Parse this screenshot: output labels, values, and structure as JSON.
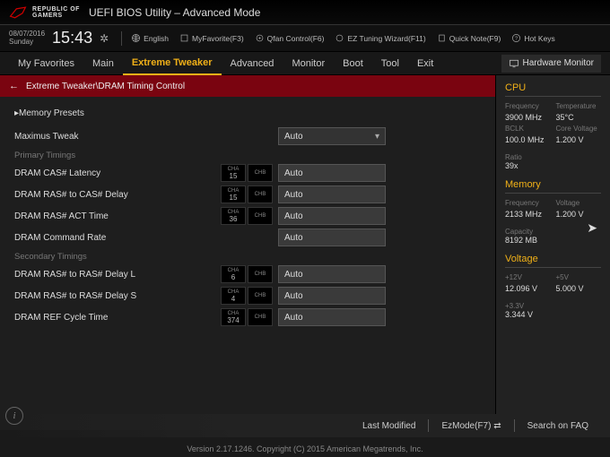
{
  "brand": {
    "line1": "REPUBLIC OF",
    "line2": "GAMERS"
  },
  "title": "UEFI BIOS Utility – Advanced Mode",
  "datetime": {
    "date": "08/07/2016",
    "day": "Sunday",
    "time": "15:43"
  },
  "toolbar": {
    "language": "English",
    "fav": "MyFavorite(F3)",
    "qfan": "Qfan Control(F6)",
    "eztune": "EZ Tuning Wizard(F11)",
    "quicknote": "Quick Note(F9)",
    "hotkeys": "Hot Keys"
  },
  "tabs": [
    "My Favorites",
    "Main",
    "Extreme Tweaker",
    "Advanced",
    "Monitor",
    "Boot",
    "Tool",
    "Exit"
  ],
  "active_tab": "Extreme Tweaker",
  "hw_tab": "Hardware Monitor",
  "breadcrumb": "Extreme Tweaker\\DRAM Timing Control",
  "memory_presets": "Memory Presets",
  "rows": {
    "maximus_tweak": {
      "label": "Maximus Tweak",
      "value": "Auto"
    },
    "primary_heading": "Primary Timings",
    "cas": {
      "label": "DRAM CAS# Latency",
      "cha": "15",
      "value": "Auto"
    },
    "ras_cas": {
      "label": "DRAM RAS# to CAS# Delay",
      "cha": "15",
      "value": "Auto"
    },
    "ras_act": {
      "label": "DRAM RAS# ACT Time",
      "cha": "36",
      "value": "Auto"
    },
    "cmd_rate": {
      "label": "DRAM Command Rate",
      "value": "Auto"
    },
    "secondary_heading": "Secondary Timings",
    "ras_ras_l": {
      "label": "DRAM RAS# to RAS# Delay L",
      "cha": "6",
      "value": "Auto"
    },
    "ras_ras_s": {
      "label": "DRAM RAS# to RAS# Delay S",
      "cha": "4",
      "value": "Auto"
    },
    "ref_cycle": {
      "label": "DRAM REF Cycle Time",
      "cha": "374",
      "value": "Auto"
    }
  },
  "cha_lab": "CHA",
  "chb_lab": "CHB",
  "sidebar": {
    "cpu": {
      "title": "CPU",
      "freq_lab": "Frequency",
      "freq": "3900 MHz",
      "temp_lab": "Temperature",
      "temp": "35°C",
      "bclk_lab": "BCLK",
      "bclk": "100.0 MHz",
      "cv_lab": "Core Voltage",
      "cv": "1.200 V",
      "ratio_lab": "Ratio",
      "ratio": "39x"
    },
    "memory": {
      "title": "Memory",
      "freq_lab": "Frequency",
      "freq": "2133 MHz",
      "volt_lab": "Voltage",
      "volt": "1.200 V",
      "cap_lab": "Capacity",
      "cap": "8192 MB"
    },
    "voltage": {
      "title": "Voltage",
      "v12_lab": "+12V",
      "v12": "12.096 V",
      "v5_lab": "+5V",
      "v5": "5.000 V",
      "v33_lab": "+3.3V",
      "v33": "3.344 V"
    }
  },
  "footer": {
    "last_modified": "Last Modified",
    "ezmode": "EzMode(F7)",
    "search": "Search on FAQ"
  },
  "copyright": "Version 2.17.1246. Copyright (C) 2015 American Megatrends, Inc."
}
